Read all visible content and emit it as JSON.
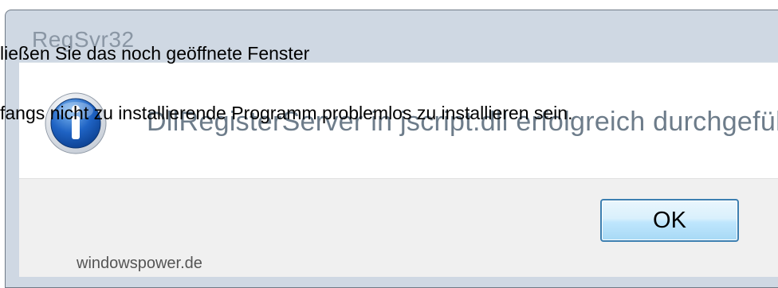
{
  "dialog": {
    "title": "RegSvr32",
    "message": "DllRegisterServer in jscript.dll erfolgreich durchgeführt.",
    "icon": "information-icon",
    "ok_label": "OK",
    "accent_color": "#3c7fb1"
  },
  "overlay": {
    "line1": "ließen Sie das noch geöffnete Fenster",
    "line2": "fangs nicht zu installierende Programm problemlos zu installieren sein."
  },
  "watermark": "windowspower.de"
}
